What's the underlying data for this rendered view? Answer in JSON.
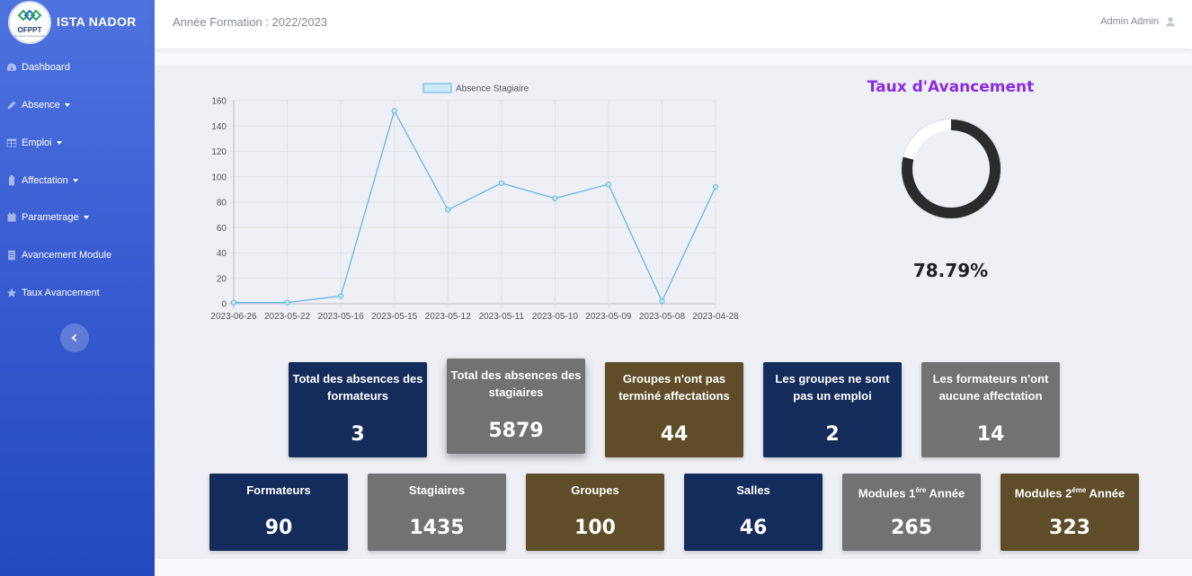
{
  "app": {
    "brand": "ISTA NADOR",
    "logo_text": "OFPPT",
    "logo_subtext": "Formation Professionnelle"
  },
  "topbar": {
    "year_label": "Année Formation : 2022/2023",
    "user_name": "Admin Admin"
  },
  "sidebar": {
    "items": [
      {
        "label": "Dashboard",
        "icon": "dashboard-icon",
        "dropdown": false
      },
      {
        "label": "Absence",
        "icon": "pencil-icon",
        "dropdown": true
      },
      {
        "label": "Emploi",
        "icon": "table-icon",
        "dropdown": true
      },
      {
        "label": "Affectation",
        "icon": "clipboard-icon",
        "dropdown": true
      },
      {
        "label": "Parametrage",
        "icon": "calendar-icon",
        "dropdown": true
      },
      {
        "label": "Avancement Module",
        "icon": "document-icon",
        "dropdown": false
      },
      {
        "label": "Taux Avancement",
        "icon": "star-icon",
        "dropdown": false
      }
    ],
    "toggle_icon": "chevron-left-icon"
  },
  "chart_data": {
    "type": "line",
    "categories": [
      "2023-06-26",
      "2023-05-22",
      "2023-05-16",
      "2023-05-15",
      "2023-05-12",
      "2023-05-11",
      "2023-05-10",
      "2023-05-09",
      "2023-05-08",
      "2023-04-28"
    ],
    "series": [
      {
        "name": "Absence Stagiaire",
        "values": [
          1,
          1,
          6,
          152,
          74,
          95,
          83,
          94,
          2,
          92
        ],
        "color": "#5cb3e6"
      }
    ],
    "yticks": [
      0,
      20,
      40,
      60,
      80,
      100,
      120,
      140,
      160
    ],
    "ylim": [
      0,
      160
    ],
    "grid": true,
    "legend": "top"
  },
  "taux": {
    "title": "Taux d'Avancement",
    "value_label": "78.79%",
    "value": 78.79,
    "fill_color": "#2b2b2b",
    "track_color": "#ffffff"
  },
  "stats_row1": [
    {
      "label": "Total des absences des formateurs",
      "value": "3",
      "color": "navy"
    },
    {
      "label": "Total des absences des stagiaires",
      "value": "5879",
      "color": "gray"
    },
    {
      "label": "Groupes n'ont pas terminé affectations",
      "value": "44",
      "color": "olive"
    },
    {
      "label": "Les groupes ne sont pas un emploi",
      "value": "2",
      "color": "navy"
    },
    {
      "label": "Les formateurs n'ont aucune affectation",
      "value": "14",
      "color": "gray"
    }
  ],
  "stats_row2": [
    {
      "label": "Formateurs",
      "value": "90",
      "color": "navy"
    },
    {
      "label": "Stagiaires",
      "value": "1435",
      "color": "gray"
    },
    {
      "label": "Groupes",
      "value": "100",
      "color": "olive"
    },
    {
      "label": "Salles",
      "value": "46",
      "color": "navy"
    },
    {
      "label_prefix": "Modules 1",
      "label_sup": "ére",
      "label_suffix": " Année",
      "value": "265",
      "color": "gray"
    },
    {
      "label_prefix": "Modules 2",
      "label_sup": "éme",
      "label_suffix": " Année",
      "value": "323",
      "color": "olive"
    }
  ]
}
